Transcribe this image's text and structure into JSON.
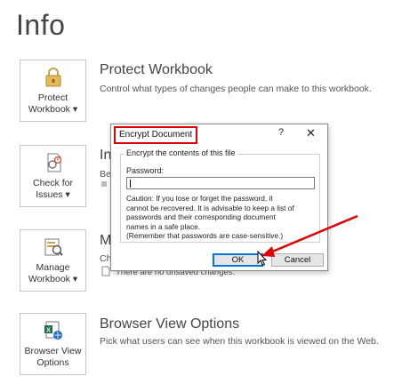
{
  "page": {
    "title": "Info"
  },
  "sections": [
    {
      "tile_label_1": "Protect",
      "tile_label_2": "Workbook",
      "tile_icon": "lock-icon",
      "title": "Protect Workbook",
      "description": "Control what types of changes people can make to this workbook."
    },
    {
      "tile_label_1": "Check for",
      "tile_label_2": "Issues",
      "tile_icon": "check-document-icon",
      "title": "Ins",
      "description": "Befo"
    },
    {
      "tile_label_1": "Manage",
      "tile_label_2": "Workbook",
      "tile_icon": "manage-workbook-icon",
      "title": "M",
      "description": "Che",
      "note": "There are no unsaved changes."
    },
    {
      "tile_label_1": "Browser View",
      "tile_label_2": "Options",
      "tile_icon": "excel-globe-icon",
      "title": "Browser View Options",
      "description": "Pick what users can see when this workbook is viewed on the Web."
    }
  ],
  "dialog": {
    "title": "Encrypt Document",
    "help": "?",
    "close": "✕",
    "group_label": "Encrypt the contents of this file",
    "password_label": "Password:",
    "password_value": "",
    "caution_lines": [
      "Caution: If you lose or forget the password, it",
      "cannot be recovered. It is advisable to keep a list of",
      "passwords and their corresponding document",
      "names in a safe place.",
      "(Remember that passwords are case-sensitive.)"
    ],
    "ok_label": "OK",
    "cancel_label": "Cancel"
  },
  "colors": {
    "highlight": "#e00000",
    "accent": "#0078d7"
  }
}
